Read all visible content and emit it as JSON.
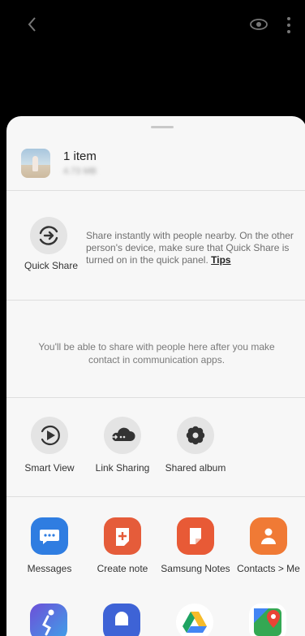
{
  "share_sheet": {
    "item_count": "1 item",
    "item_size": "4.73 MB"
  },
  "quick_share": {
    "label": "Quick Share",
    "description": "Share instantly with people nearby. On the other person's device, make sure that Quick Share is turned on in the quick panel.",
    "tips_link": "Tips"
  },
  "contacts_notice": "You'll be able to share with people here after you make contact in communication apps.",
  "share_options": [
    {
      "label": "Smart View",
      "icon": "smart-view-icon"
    },
    {
      "label": "Link Sharing",
      "icon": "cloud-link-icon"
    },
    {
      "label": "Shared album",
      "icon": "flower-icon"
    }
  ],
  "apps": [
    {
      "label": "Messages",
      "icon": "messages-icon",
      "color": "#2f7de1"
    },
    {
      "label": "Create note",
      "icon": "create-note-icon",
      "color": "#e55c3a"
    },
    {
      "label": "Samsung Notes",
      "icon": "samsung-notes-icon",
      "color": "#e85a36"
    },
    {
      "label": "Contacts > Me",
      "icon": "contacts-icon",
      "color": "#f07a35"
    }
  ],
  "colors": {
    "accent_blue": "#2f7de1",
    "accent_orange": "#e85a36"
  }
}
